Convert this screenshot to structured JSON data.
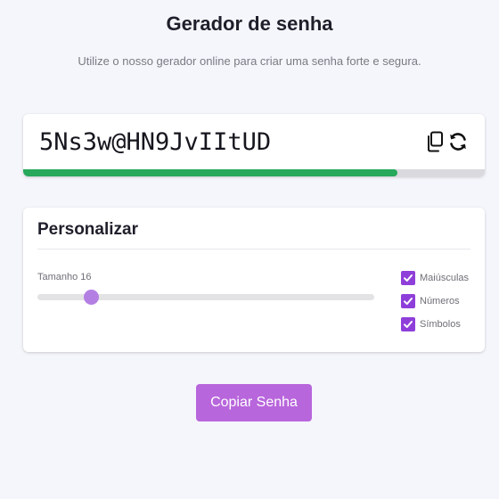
{
  "header": {
    "title": "Gerador de senha",
    "subtitle": "Utilize o nosso gerador online para criar uma senha forte e segura."
  },
  "password": {
    "value": "5Ns3w@HN9JvIItUD",
    "strength_fraction": 0.81,
    "strength_color": "#27a85c",
    "copy_icon": "copy-icon",
    "refresh_icon": "refresh-icon"
  },
  "customize": {
    "heading": "Personalizar",
    "length_label": "Tamanho 16",
    "length_value": 16,
    "length_fraction": 0.16,
    "options": [
      {
        "label": "Maiúsculas",
        "checked": true
      },
      {
        "label": "Números",
        "checked": true
      },
      {
        "label": "Símbolos",
        "checked": true
      }
    ]
  },
  "actions": {
    "copy_label": "Copiar Senha"
  },
  "colors": {
    "accent": "#b866dc",
    "checkbox": "#8f3fd9",
    "slider_thumb": "#b47fe3",
    "background": "#f5f6fb"
  }
}
